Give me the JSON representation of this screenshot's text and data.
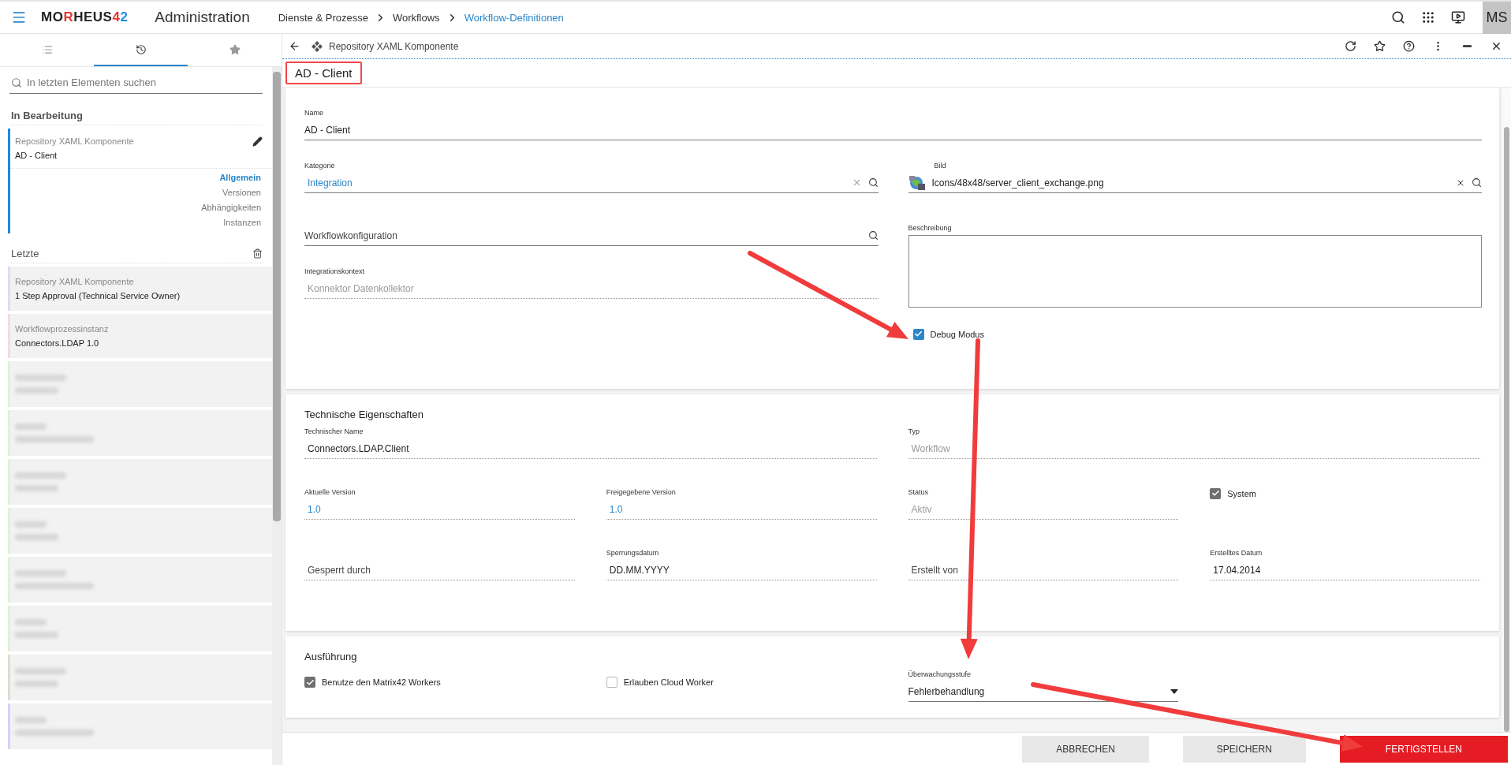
{
  "app_bar": {
    "logo": [
      {
        "text": "MO",
        "color": "#222222"
      },
      {
        "text": "R",
        "color": "#e53935"
      },
      {
        "text": "HEUS",
        "color": "#222222"
      },
      {
        "text": "4",
        "color": "#e53935"
      },
      {
        "text": "2",
        "color": "#1e88e5"
      }
    ],
    "title": "Administration",
    "breadcrumbs": [
      {
        "label": "Dienste & Prozesse",
        "selected": false
      },
      {
        "label": "Workflows",
        "selected": false
      },
      {
        "label": "Workflow-Definitionen",
        "selected": true
      }
    ],
    "user": "MS"
  },
  "sidebar": {
    "tabs": [
      {
        "selected": false
      },
      {
        "selected": true
      },
      {
        "selected": false
      }
    ],
    "search": {
      "placeholder": "In letzten Elementen suchen"
    },
    "editing": {
      "heading": "In Bearbeitung",
      "item": {
        "type": "Repository XAML Komponente",
        "name": "AD - Client",
        "color": "#1e88e5"
      },
      "links": [
        {
          "label": "Allgemein",
          "selected": true
        },
        {
          "label": "Versionen",
          "selected": false
        },
        {
          "label": "Abhängigkeiten",
          "selected": false
        },
        {
          "label": "Instanzen",
          "selected": false
        }
      ]
    },
    "recent": {
      "heading": "Letzte",
      "items": [
        {
          "kind": "item",
          "type": "Repository XAML Komponente",
          "name": "1 Step Approval (Technical Service Owner)",
          "color": "#dcdcf4"
        },
        {
          "kind": "item",
          "type": "Workflowprozessinstanz",
          "name": "Connectors.LDAP 1.0",
          "color": "#f6dcdc"
        },
        {
          "kind": "blurred",
          "color": "#dcf5d2"
        },
        {
          "kind": "blurred",
          "color": "#dcf5d2"
        },
        {
          "kind": "blurred",
          "color": "#dcf5d2"
        },
        {
          "kind": "blurred",
          "color": "#dcf5d2"
        },
        {
          "kind": "blurred",
          "color": "#dcf5d2"
        },
        {
          "kind": "blurred",
          "color": "#dcf5d2"
        },
        {
          "kind": "blurred",
          "color": "#dcdcd0"
        },
        {
          "kind": "blurred",
          "color": "#d6d0fa"
        }
      ]
    }
  },
  "main": {
    "breadcrumb": "Repository XAML Komponente",
    "title": "AD - Client",
    "title_marked": true,
    "general": {
      "name": {
        "kind": "input",
        "label": "Name",
        "value": "AD - Client"
      },
      "columns": [
        [
          {
            "kind": "lookup",
            "label": "Kategorie",
            "value": "Integration",
            "link": true,
            "clearable": true
          },
          {
            "kind": "lookup",
            "placeholder": "Workflowkonfiguration",
            "clearable": false
          },
          {
            "kind": "readonly",
            "label": "Integrationskontext",
            "value": "Konnektor Datenkollektor",
            "disabled": true
          }
        ],
        [
          {
            "kind": "image",
            "label": "Bild",
            "value": "Icons/48x48/server_client_exchange.png"
          },
          {
            "kind": "textarea",
            "label": "Beschreibung"
          },
          {
            "kind": "checkbox",
            "label": "Debug Modus",
            "checked": true,
            "disabled": false
          }
        ]
      ]
    },
    "technical": {
      "title": "Technische Eigenschaften",
      "rows": [
        [
          {
            "kind": "readonly",
            "label": "Technischer Name",
            "value": "Connectors.LDAP.Client"
          },
          "",
          {
            "kind": "readonly",
            "label": "Typ",
            "value": "Workflow",
            "disabled": true
          },
          ""
        ],
        [
          {
            "kind": "readonly",
            "label": "Aktuelle Version",
            "value": "1.0",
            "link": true
          },
          {
            "kind": "readonly",
            "label": "Freigegebene Version",
            "value": "1.0",
            "link": true
          },
          {
            "kind": "readonly",
            "label": "Status",
            "value": "Aktiv",
            "disabled": true
          },
          {
            "kind": "checkbox",
            "label": "System",
            "checked": true,
            "disabled": true
          }
        ],
        [
          {
            "kind": "readonly",
            "placeholder": "Gesperrt durch"
          },
          {
            "kind": "readonly",
            "label": "Sperrungsdatum",
            "value": "DD.MM.YYYY"
          },
          {
            "kind": "readonly",
            "placeholder": "Erstellt von"
          },
          {
            "kind": "readonly",
            "label": "Erstelltes Datum",
            "value": "17.04.2014"
          }
        ]
      ]
    },
    "execution": {
      "title": "Ausführung",
      "row": [
        {
          "kind": "checkbox",
          "label": "Benutze den Matrix42 Workers",
          "checked": true,
          "disabled": true
        },
        {
          "kind": "checkbox",
          "label": "Erlauben Cloud Worker",
          "checked": false,
          "disabled": true
        },
        {
          "kind": "select",
          "label": "Überwachungsstufe",
          "value": "Fehlerbehandlung"
        },
        {
          "kind": "empty"
        }
      ]
    },
    "buttons": [
      {
        "label": "ABBRECHEN",
        "kind": "secondary"
      },
      {
        "label": "SPEICHERN",
        "kind": "secondary"
      },
      {
        "label": "FERTIGSTELLEN",
        "kind": "primary"
      }
    ]
  }
}
